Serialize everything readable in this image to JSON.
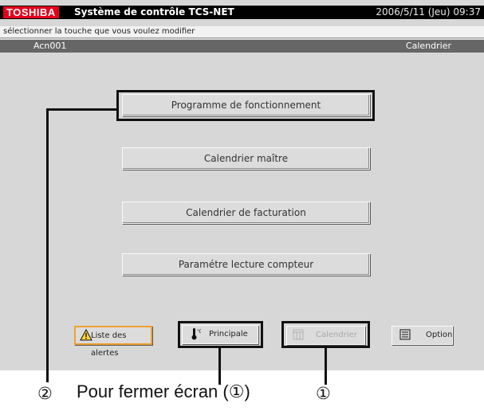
{
  "titlebar": {
    "brand": "TOSHIBA",
    "title": "Système de contrôle TCS-NET",
    "datetime": "2006/5/11 (Jeu) 09:37"
  },
  "hint": "sélectionner la touche que vous voulez modifier",
  "breadcrumb": {
    "left": "Acn001",
    "right": "Calendrier"
  },
  "menu": [
    {
      "label": "Programme de fonctionnement",
      "highlighted": true
    },
    {
      "label": "Calendrier maître"
    },
    {
      "label": "Calendrier de facturation"
    },
    {
      "label": "Paramétre lecture compteur"
    }
  ],
  "toolbar": {
    "alerts": "Liste des alertes",
    "main": "Principale",
    "calendar": "Calendrier",
    "option": "Option"
  },
  "annotations": {
    "marker_2": "②",
    "marker_1": "①",
    "caption": "Pour fermer écran (①)"
  },
  "colors": {
    "brand": "#e4001b",
    "screen_bg": "#d7d7d7",
    "alert_border": "#f0a032"
  }
}
